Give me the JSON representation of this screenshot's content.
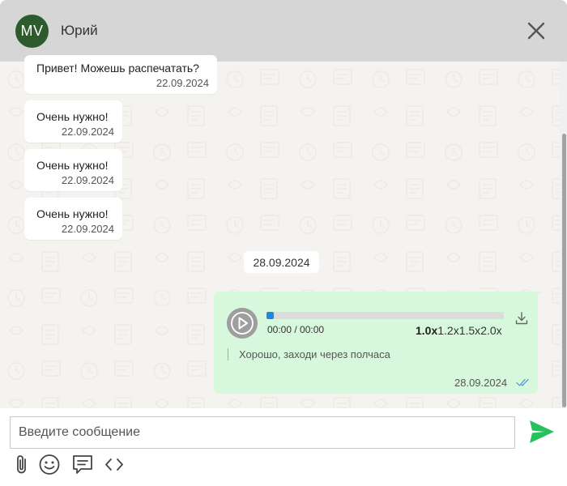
{
  "header": {
    "avatar_initials": "MV",
    "avatar_color": "#2e5b2c",
    "contact_name": "Юрий",
    "close_icon": "close-icon"
  },
  "messages": [
    {
      "text": "Привет! Можешь распечатать?",
      "time": "22.09.2024"
    },
    {
      "text": "Очень нужно!",
      "time": "22.09.2024"
    },
    {
      "text": "Очень нужно!",
      "time": "22.09.2024"
    },
    {
      "text": "Очень нужно!",
      "time": "22.09.2024"
    }
  ],
  "date_separator": "28.09.2024",
  "voice_message": {
    "elapsed": "00:00",
    "separator": " / ",
    "duration": "00:00",
    "progress_fraction": 0.03,
    "speeds": [
      "1.0x",
      "1.2x",
      "1.5x",
      "2.0x"
    ],
    "active_speed": "1.0x",
    "transcript": "Хорошо, заходи через полчаса",
    "time": "28.09.2024",
    "status_icon": "double-check-icon",
    "bubble_color": "#d7f8dc",
    "play_icon": "play-icon",
    "download_icon": "download-icon"
  },
  "composer": {
    "placeholder": "Введите сообщение",
    "value": "",
    "send_icon": "send-icon",
    "send_color": "#25c15d",
    "tools": [
      "paperclip-icon",
      "emoji-icon",
      "templates-icon",
      "code-icon"
    ]
  }
}
